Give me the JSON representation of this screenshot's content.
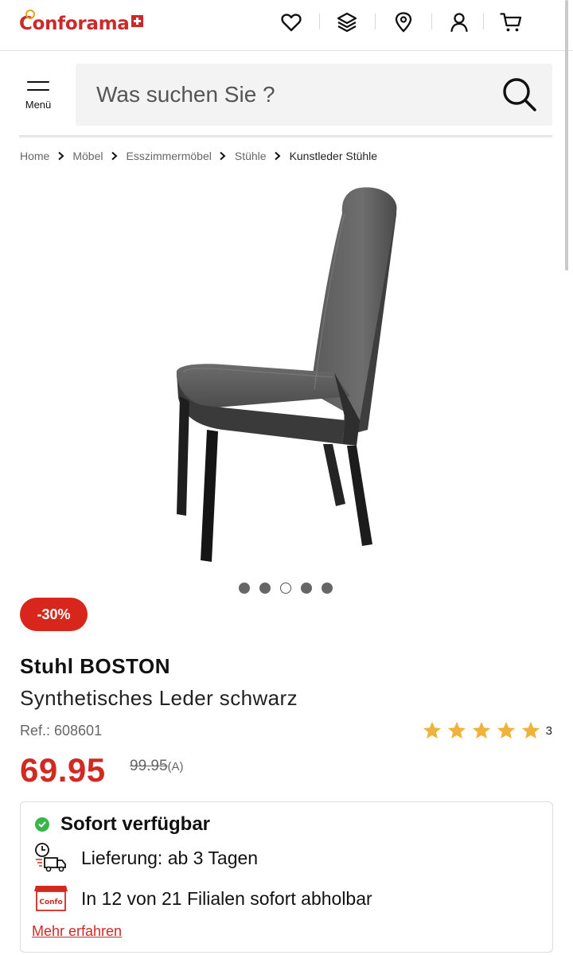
{
  "brand": {
    "logo_text": "Conforama",
    "accent_color": "#cc2a2a"
  },
  "header": {
    "icons": [
      "heart-icon",
      "layers-icon",
      "location-pin-icon",
      "user-icon",
      "cart-icon"
    ]
  },
  "search": {
    "menu_label": "Menü",
    "placeholder": "Was suchen Sie ?"
  },
  "breadcrumb": {
    "items": [
      "Home",
      "Möbel",
      "Esszimmermöbel",
      "Stühle",
      "Kunstleder Stühle"
    ]
  },
  "gallery": {
    "slide_count": 5,
    "active_index": 2
  },
  "product": {
    "discount_badge": "-30%",
    "title": "Stuhl BOSTON",
    "subtitle": "Synthetisches Leder schwarz",
    "ref": "Ref.: 608601",
    "rating": {
      "stars": 5,
      "count": "3",
      "star_color": "#efb33c"
    },
    "price": "69.95",
    "old_price": "99.95",
    "old_price_suffix": "(A)",
    "price_color": "#d02a22"
  },
  "availability": {
    "status": "Sofort verfügbar",
    "delivery": "Lieferung: ab 3 Tagen",
    "pickup": "In 12 von 21 Filialen sofort abholbar",
    "pickup_icon_label": "Confo",
    "more_link": "Mehr erfahren",
    "status_color": "#3bb54a"
  }
}
